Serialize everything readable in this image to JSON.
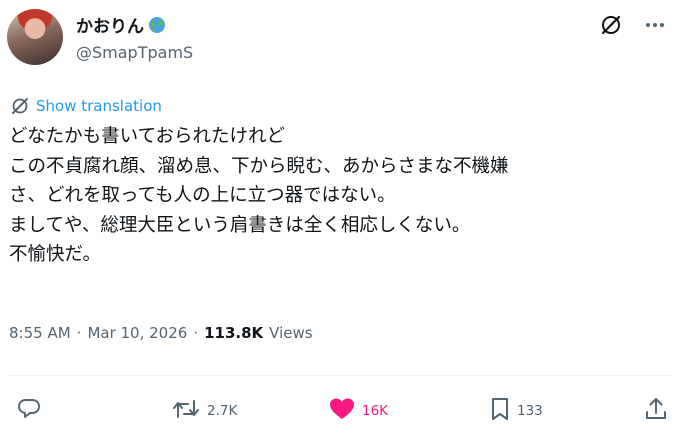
{
  "author": {
    "display_name": "かおりん",
    "badge_icon": "globe-icon",
    "handle": "@SmapTpamS"
  },
  "header_icons": [
    "grok-icon",
    "more-icon"
  ],
  "translate_label": "Show translation",
  "tweet": {
    "text": "どなたかも書いておられたけれど\nこの不貞腐れ顔、溜め息、下から睨む、あからさまな不機嫌\nさ、どれを取っても人の上に立つ器ではない。\nましてや、総理大臣という肩書きは全く相応しくない。\n不愉快だ。"
  },
  "meta": {
    "time": "8:55 AM",
    "sep1": "·",
    "date": "Mar 10, 2026",
    "sep2": "·",
    "views_count": "113.8K",
    "views_label": "Views"
  },
  "actions": {
    "reply_count": "",
    "retweet_count": "2.7K",
    "like_count": "16K",
    "bookmark_count": "133"
  },
  "colors": {
    "accent": "#1d9bf0",
    "like": "#f91880",
    "muted": "#536471",
    "text": "#0f1419"
  }
}
